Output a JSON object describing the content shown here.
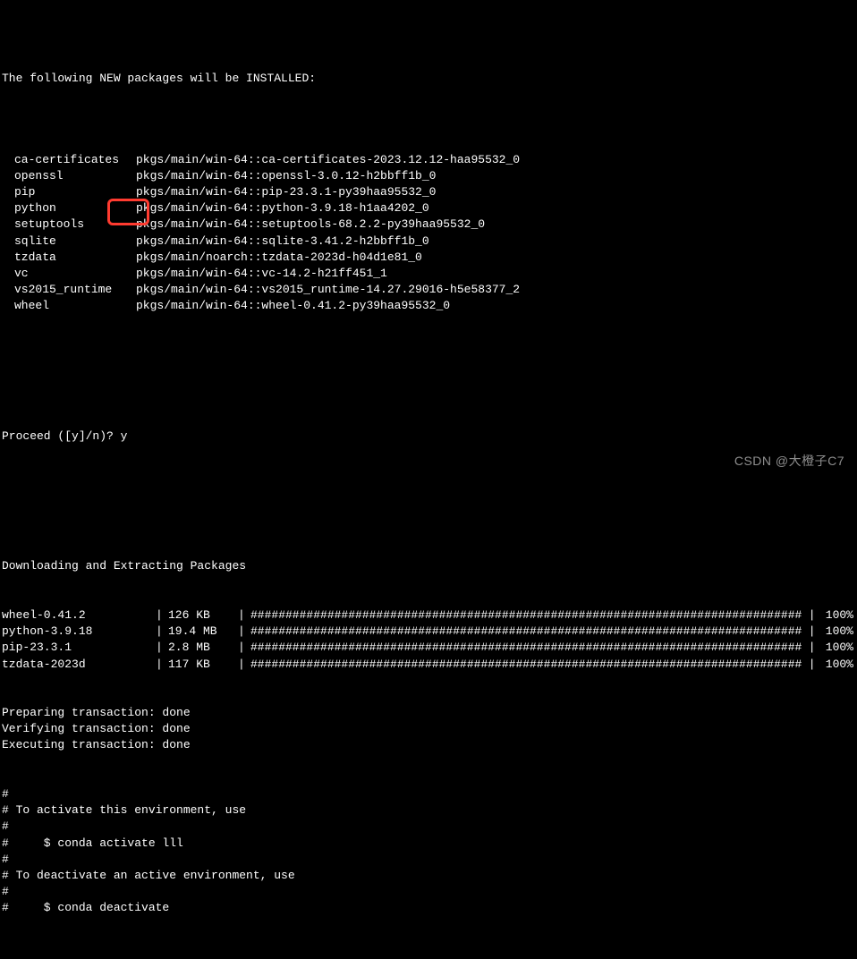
{
  "header": "The following NEW packages will be INSTALLED:",
  "packages": [
    {
      "name": "ca-certificates",
      "spec": "pkgs/main/win-64::ca-certificates-2023.12.12-haa95532_0"
    },
    {
      "name": "openssl",
      "spec": "pkgs/main/win-64::openssl-3.0.12-h2bbff1b_0"
    },
    {
      "name": "pip",
      "spec": "pkgs/main/win-64::pip-23.3.1-py39haa95532_0"
    },
    {
      "name": "python",
      "spec": "pkgs/main/win-64::python-3.9.18-h1aa4202_0"
    },
    {
      "name": "setuptools",
      "spec": "pkgs/main/win-64::setuptools-68.2.2-py39haa95532_0"
    },
    {
      "name": "sqlite",
      "spec": "pkgs/main/win-64::sqlite-3.41.2-h2bbff1b_0"
    },
    {
      "name": "tzdata",
      "spec": "pkgs/main/noarch::tzdata-2023d-h04d1e81_0"
    },
    {
      "name": "vc",
      "spec": "pkgs/main/win-64::vc-14.2-h21ff451_1"
    },
    {
      "name": "vs2015_runtime",
      "spec": "pkgs/main/win-64::vs2015_runtime-14.27.29016-h5e58377_2"
    },
    {
      "name": "wheel",
      "spec": "pkgs/main/win-64::wheel-0.41.2-py39haa95532_0"
    }
  ],
  "prompt": {
    "text": "Proceed ([y]/n)? ",
    "input": "y"
  },
  "download_header": "Downloading and Extracting Packages",
  "downloads": [
    {
      "name": "wheel-0.41.2",
      "size": "126 KB",
      "pct": "100%"
    },
    {
      "name": "python-3.9.18",
      "size": "19.4 MB",
      "pct": "100%"
    },
    {
      "name": "pip-23.3.1",
      "size": "2.8 MB",
      "pct": "100%"
    },
    {
      "name": "tzdata-2023d",
      "size": "117 KB",
      "pct": "100%"
    }
  ],
  "bar": "################################################################################",
  "sep": "| ",
  "transactions": [
    "Preparing transaction: done",
    "Verifying transaction: done",
    "Executing transaction: done"
  ],
  "help": [
    "#",
    "# To activate this environment, use",
    "#",
    "#     $ conda activate lll",
    "#",
    "# To deactivate an active environment, use",
    "#",
    "#     $ conda deactivate"
  ],
  "watermark": "CSDN @大橙子C7"
}
